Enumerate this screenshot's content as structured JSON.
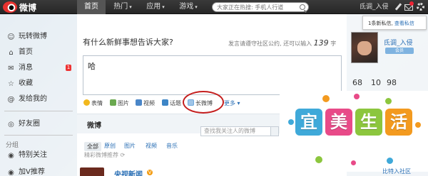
{
  "topbar": {
    "logo_text": "微博",
    "nav": [
      {
        "label": "首页",
        "caret": ""
      },
      {
        "label": "热门",
        "caret": "▾"
      },
      {
        "label": "应用",
        "caret": "▾"
      },
      {
        "label": "游戏",
        "caret": "▾"
      }
    ],
    "search_placeholder": "大家正在热搜: 手机人行道",
    "username": "氐调_入侵"
  },
  "sidebar": {
    "items": [
      {
        "label": "玩转微博",
        "icon": "user-circle-icon",
        "glyph": "☺"
      },
      {
        "label": "首页",
        "icon": "home-icon",
        "glyph": "⌂"
      },
      {
        "label": "消息",
        "icon": "message-icon",
        "glyph": "✉",
        "badge": "1"
      },
      {
        "label": "收藏",
        "icon": "star-icon",
        "glyph": "☆"
      },
      {
        "label": "发给我的",
        "icon": "at-icon",
        "glyph": "@"
      },
      {
        "label": "好友圈",
        "icon": "circle-icon",
        "glyph": "◎"
      }
    ],
    "group_label": "分组",
    "group_items": [
      {
        "label": "特别关注",
        "icon": "bullet-icon",
        "glyph": "◉"
      },
      {
        "label": "加V推荐",
        "icon": "bullet-icon",
        "glyph": "◉"
      }
    ]
  },
  "composer": {
    "prompt": "有什么新鲜事想告诉大家?",
    "notice_prefix": "发言请遵守社区公约, 还可以输入",
    "notice_count": "139",
    "notice_suffix": "字",
    "text": "哈",
    "tools": [
      {
        "label": "表情",
        "icon": "emoji-icon"
      },
      {
        "label": "图片",
        "icon": "image-icon"
      },
      {
        "label": "视频",
        "icon": "video-icon"
      },
      {
        "label": "话题",
        "icon": "topic-icon"
      },
      {
        "label": "长微博",
        "icon": "long-post-icon"
      },
      {
        "label": "更多 ▾",
        "icon": ""
      }
    ]
  },
  "feed": {
    "tab": "微博",
    "search_placeholder": "查找我关注人的微博",
    "filters": [
      "全部",
      "原创",
      "图片",
      "视频",
      "音乐"
    ],
    "recommend": "精彩微博推荐 ⟳",
    "first_author": "央视新闻",
    "first_author_badge": "V"
  },
  "right_panel": {
    "popup_text": "1条新私信,",
    "popup_link": "查看私信",
    "profile_name": "氐调_入侵",
    "profile_badge": "会员",
    "stats": [
      "68",
      "10",
      "98"
    ],
    "fans_link": "比特入社区"
  },
  "promo": {
    "chars": [
      {
        "text": "宜",
        "color": "#3fa9d9"
      },
      {
        "text": "美",
        "color": "#e84a88"
      },
      {
        "text": "生",
        "color": "#8cc63e"
      },
      {
        "text": "活",
        "color": "#f39a1f"
      }
    ]
  }
}
